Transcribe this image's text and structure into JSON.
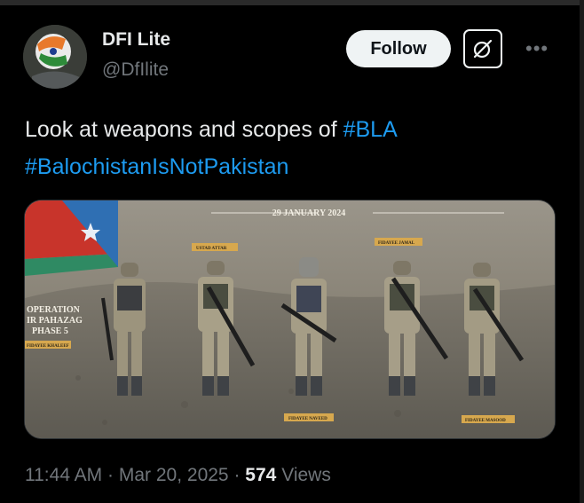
{
  "author": {
    "name": "DFI Lite",
    "handle": "@DfIlite"
  },
  "actions": {
    "follow_label": "Follow",
    "grok_icon": "grok-icon",
    "more_icon": "more-dots-icon"
  },
  "tweet": {
    "text": "Look at weapons and scopes of",
    "hashtags": [
      "#BLA",
      "#BalochistanIsNotPakistan"
    ]
  },
  "media": {
    "date_banner": "29 JANUARY 2024",
    "operation_lines": [
      "OPERATION",
      "IR PAHAZAG",
      "PHASE 5"
    ],
    "name_tags": [
      "FIDAYEE KHALEEF",
      "USTAD ATTAR",
      "FIDAYEE NAVEED",
      "FIDAYEE JAMAL",
      "FIDAYEE MASOOD"
    ]
  },
  "meta": {
    "time": "11:44 AM",
    "separator": "·",
    "date": "Mar 20, 2025",
    "views_count": "574",
    "views_label": "Views"
  },
  "colors": {
    "background": "#000000",
    "accent": "#1d9bf0",
    "muted": "#71767b"
  }
}
